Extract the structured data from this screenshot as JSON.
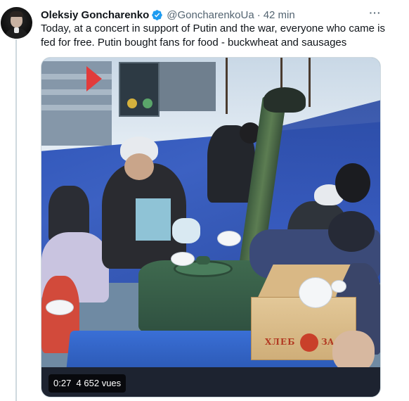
{
  "tweet": {
    "author_name": "Oleksiy Goncharenko",
    "handle": "@GoncharenkoUa",
    "separator": "·",
    "time": "42 min",
    "more_label": "···",
    "text": "Today, at a concert in support of Putin and the war, everyone who came is fed for free. Putin bought fans for food - buckwheat and sausages",
    "verified": true
  },
  "media": {
    "type": "video",
    "duration": "0:27",
    "views": "4 652 vues",
    "crate_text_left": "ХЛЕБ",
    "crate_text_right": "ЗА"
  },
  "colors": {
    "verified_blue": "#1d9bf0",
    "secondary_text": "#536471",
    "primary_text": "#0f1419"
  }
}
